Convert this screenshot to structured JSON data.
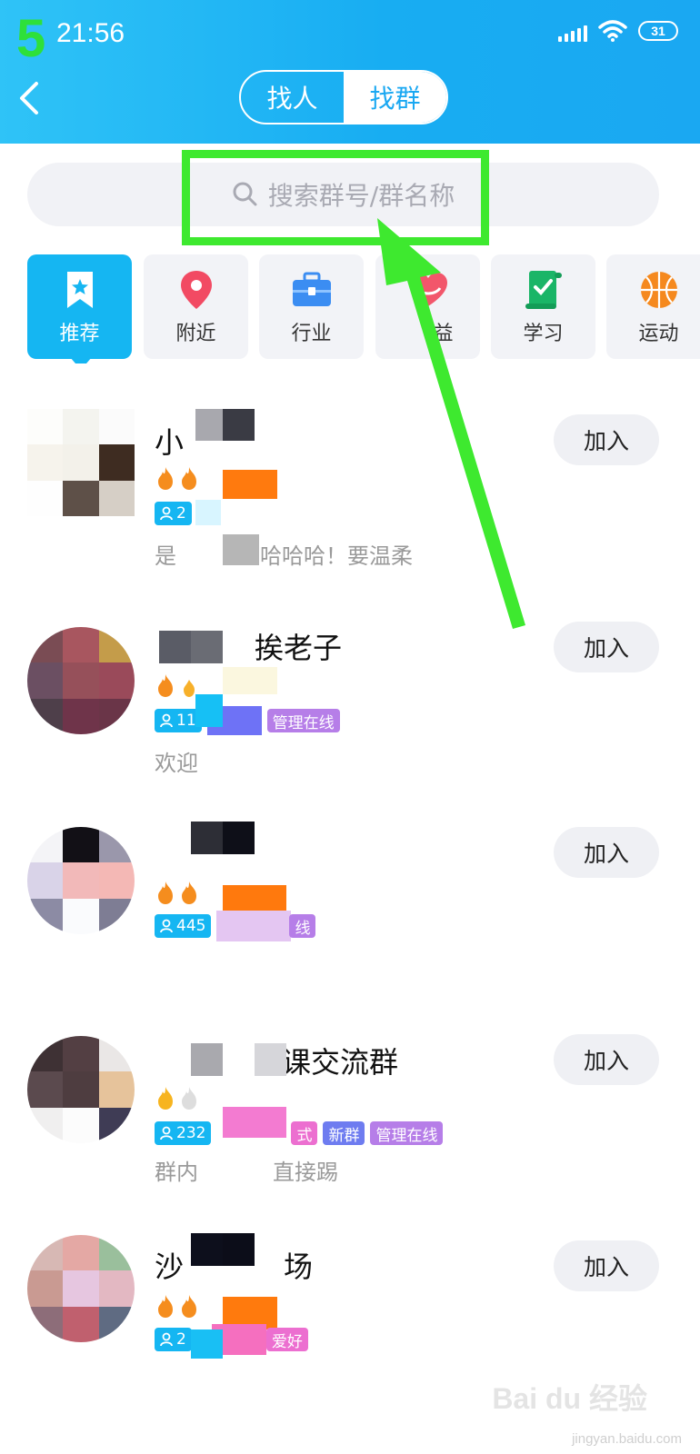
{
  "status": {
    "step_label": "5",
    "time": "21:56",
    "battery": "31"
  },
  "tabs": {
    "find_person": "找人",
    "find_group": "找群"
  },
  "search": {
    "placeholder": "搜索群号/群名称"
  },
  "categories": [
    {
      "label": "推荐",
      "icon": "bookmark-star-icon",
      "active": true
    },
    {
      "label": "附近",
      "icon": "location-pin-icon"
    },
    {
      "label": "行业",
      "icon": "briefcase-icon"
    },
    {
      "label": "益",
      "icon": "heart-icon"
    },
    {
      "label": "学习",
      "icon": "scroll-check-icon"
    },
    {
      "label": "运动",
      "icon": "basketball-icon"
    }
  ],
  "groups": [
    {
      "name_prefix": "小",
      "name_suffix": "",
      "member_count": "2",
      "tags": [],
      "desc_prefix": "是",
      "desc_suffix": "哈哈哈！要温柔",
      "join": "加入"
    },
    {
      "name_prefix": "",
      "name_suffix": "挨老子",
      "member_count": "11",
      "tags": [
        "管理在线"
      ],
      "desc_prefix": "欢迎",
      "desc_suffix": "",
      "join": "加入"
    },
    {
      "name_prefix": "",
      "name_suffix": "",
      "member_count": "445",
      "tags": [
        "线"
      ],
      "desc_prefix": "",
      "desc_suffix": "",
      "join": "加入"
    },
    {
      "name_prefix": "",
      "name_suffix": "课交流群",
      "member_count": "232",
      "tags": [
        "式",
        "新群",
        "管理在线"
      ],
      "desc_prefix": "群内",
      "desc_suffix": "直接踢",
      "join": "加入"
    },
    {
      "name_prefix": "沙",
      "name_suffix": "场",
      "member_count": "2",
      "tags": [
        "爱好"
      ],
      "desc_prefix": "",
      "desc_suffix": "",
      "join": "加入"
    }
  ],
  "watermark": {
    "logo": "Bai du 经验",
    "url": "jingyan.baidu.com"
  },
  "colors": {
    "header_blue": "#1aa8f2",
    "accent_blue": "#15b6f2",
    "annotation_green": "#3ee92f"
  }
}
